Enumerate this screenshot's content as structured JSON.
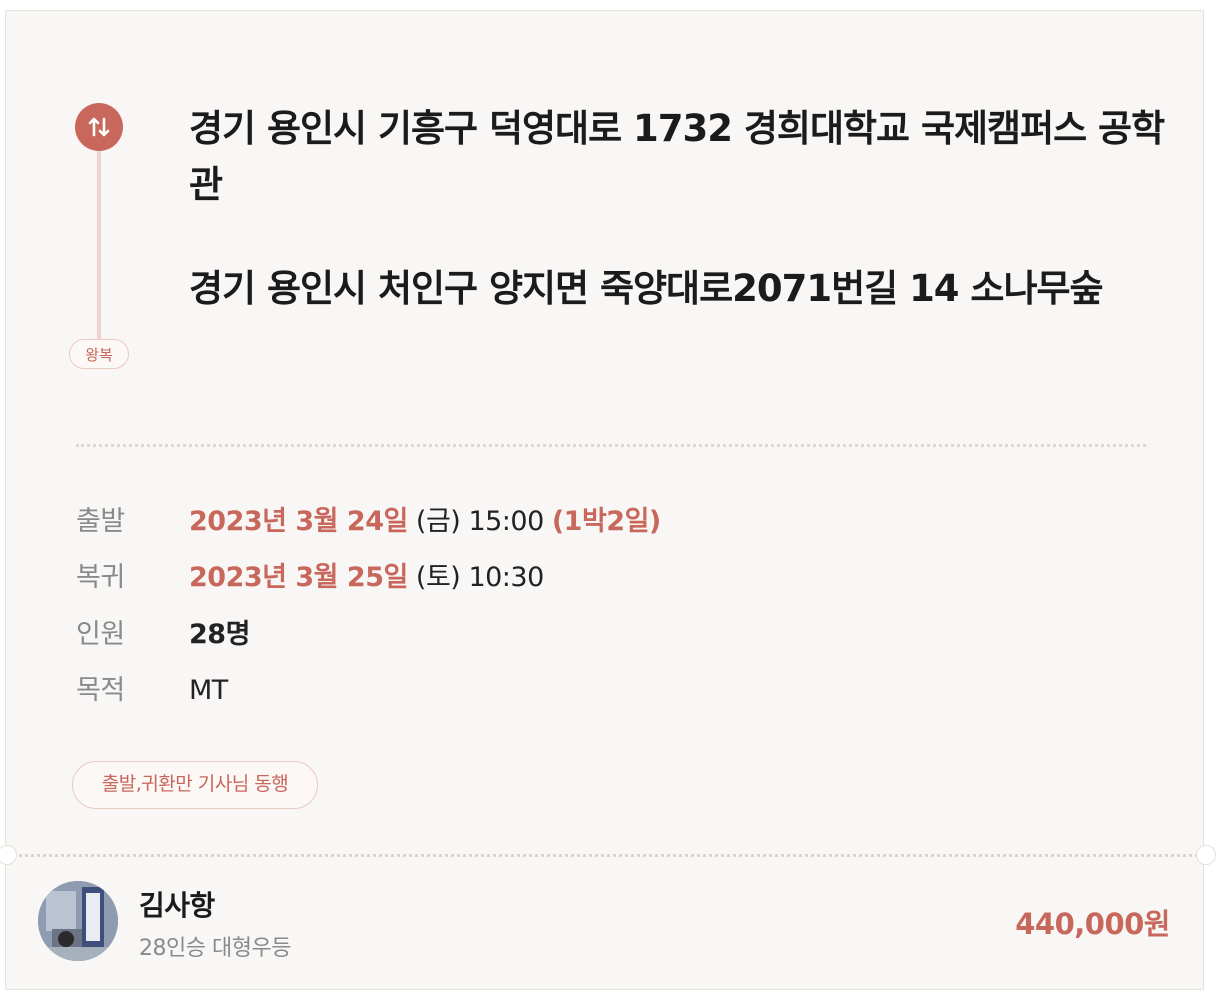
{
  "trip": {
    "route_type": "왕복",
    "origin": "경기 용인시 기흥구 덕영대로 1732 경희대학교 국제캠퍼스 공학관",
    "destination": "경기 용인시 처인구 양지면 죽양대로2071번길 14 소나무숲"
  },
  "details": {
    "departure": {
      "label": "출발",
      "date": "2023년 3월 24일",
      "weekday": "(금)",
      "time": "15:00",
      "duration": "(1박2일)"
    },
    "return": {
      "label": "복귀",
      "date": "2023년 3월 25일",
      "weekday": "(토)",
      "time": "10:30"
    },
    "passengers": {
      "label": "인원",
      "value": "28명"
    },
    "purpose": {
      "label": "목적",
      "value": "MT"
    }
  },
  "note": "출발,귀환만 기사님 동행",
  "driver": {
    "name": "김사항",
    "vehicle": "28인승 대형우등",
    "price": "440,000원"
  },
  "colors": {
    "accent": "#c8675b",
    "background": "#f9f7f5"
  },
  "icons": {
    "route": "swap-vertical-arrows-icon",
    "avatar": "driver-photo"
  }
}
